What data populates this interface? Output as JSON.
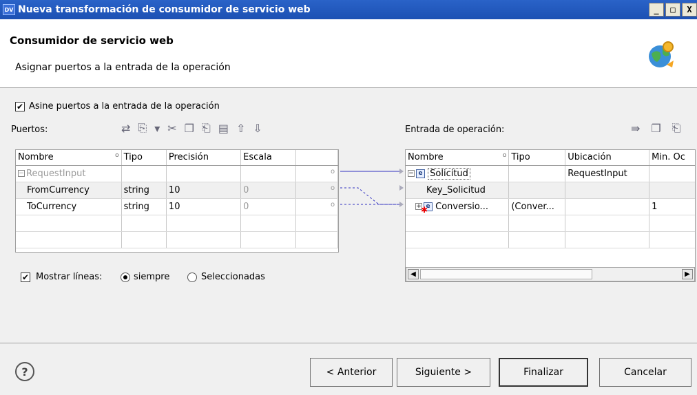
{
  "window": {
    "app_icon_text": "DV",
    "title": "Nueva transformación de consumidor de servicio web",
    "minimize": "_",
    "maximize": "□",
    "close": "X"
  },
  "header": {
    "title": "Consumidor de servicio web",
    "subtitle": "Asignar puertos a la entrada de la operación"
  },
  "assign_checkbox": {
    "label": "Asine puertos a la entrada de la operación",
    "checked": true
  },
  "ports": {
    "label": "Puertos:",
    "columns": [
      "Nombre",
      "Tipo",
      "Precisión",
      "Escala"
    ],
    "rows": [
      {
        "name": "RequestInput",
        "type": "",
        "precision": "",
        "scale": ""
      },
      {
        "name": "FromCurrency",
        "type": "string",
        "precision": "10",
        "scale": "0"
      },
      {
        "name": "ToCurrency",
        "type": "string",
        "precision": "10",
        "scale": "0"
      }
    ]
  },
  "operation": {
    "label": "Entrada de operación:",
    "columns": [
      "Nombre",
      "Tipo",
      "Ubicación",
      "Min. Oc"
    ],
    "rows": [
      {
        "name": "Solicitud",
        "type": "",
        "location": "RequestInput",
        "min": ""
      },
      {
        "name": "Key_Solicitud",
        "type": "",
        "location": "",
        "min": ""
      },
      {
        "name": "Conversio...",
        "type": "(Conver...",
        "location": "",
        "min": "1"
      }
    ]
  },
  "show_lines": {
    "label": "Mostrar líneas:",
    "checked": true,
    "always": "siempre",
    "selected": "Seleccionadas",
    "value": "siempre"
  },
  "buttons": {
    "help": "?",
    "back": "< Anterior",
    "next": "Siguiente >",
    "finish": "Finalizar",
    "cancel": "Cancelar"
  },
  "icons": [
    "help-icon",
    "globe-icon",
    "element-icon"
  ],
  "colors": {
    "title_bar": "#1c50b3",
    "link_line": "#3030c0"
  }
}
